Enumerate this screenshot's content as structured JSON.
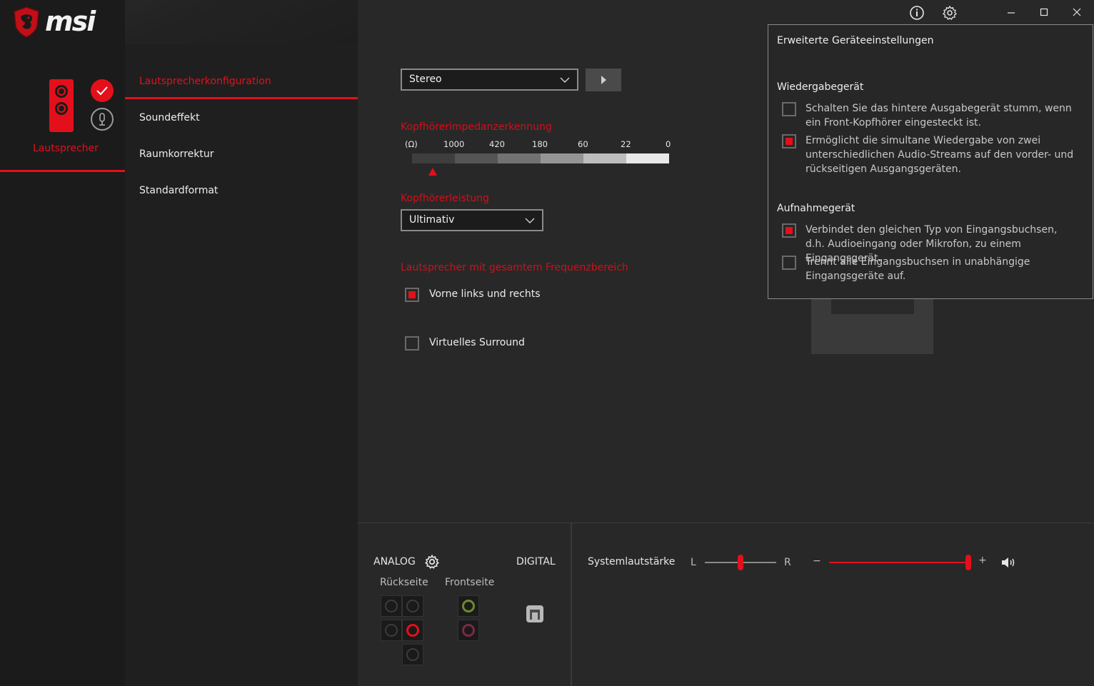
{
  "brand": {
    "logo_text": "msi"
  },
  "device": {
    "label": "Lautsprecher"
  },
  "nav": {
    "items": [
      {
        "label": "Lautsprecherkonfiguration"
      },
      {
        "label": "Soundeffekt"
      },
      {
        "label": "Raumkorrektur"
      },
      {
        "label": "Standardformat"
      }
    ]
  },
  "main": {
    "speaker_mode": {
      "value": "Stereo"
    },
    "impedance": {
      "heading": "Kopfhörerimpedanzerkennung",
      "unit": "(Ω)",
      "ticks": [
        "1000",
        "420",
        "180",
        "60",
        "22",
        "0"
      ]
    },
    "power": {
      "heading": "Kopfhörerleistung",
      "value": "Ultimativ"
    },
    "fullrange": {
      "heading": "Lautsprecher mit gesamtem Frequenzbereich",
      "front_lr": {
        "label": "Vorne links und rechts",
        "checked": true
      }
    },
    "virtual_surround": {
      "label": "Virtuelles Surround",
      "checked": false
    }
  },
  "popup": {
    "title": "Erweiterte Geräteeinstellungen",
    "playback": {
      "heading": "Wiedergabegerät",
      "options": [
        {
          "text": "Schalten Sie das hintere Ausgabegerät stumm, wenn ein Front-Kopfhörer eingesteckt ist.",
          "checked": false
        },
        {
          "text": "Ermöglicht die simultane Wiedergabe von zwei unterschiedlichen Audio-Streams auf den vorder- und rückseitigen Ausgangsgeräten.",
          "checked": true
        }
      ]
    },
    "recording": {
      "heading": "Aufnahmegerät",
      "options": [
        {
          "text": "Verbindet den gleichen Typ von Eingangsbuchsen, d.h. Audioeingang oder Mikrofon, zu einem Eingangsgerät.",
          "checked": true
        },
        {
          "text": "Trennt alle Eingangsbuchsen in unabhängige Eingangsgeräte auf.",
          "checked": false
        }
      ]
    }
  },
  "bottom": {
    "analog_label": "ANALOG",
    "digital_label": "DIGITAL",
    "rear_label": "Rückseite",
    "front_label": "Frontseite",
    "system_volume_label": "Systemlautstärke",
    "balance_left": "L",
    "balance_right": "R",
    "minus": "−",
    "plus": "+",
    "balance_value": 0.5,
    "volume_value": 1.0
  },
  "colors": {
    "accent": "#e3101b"
  }
}
